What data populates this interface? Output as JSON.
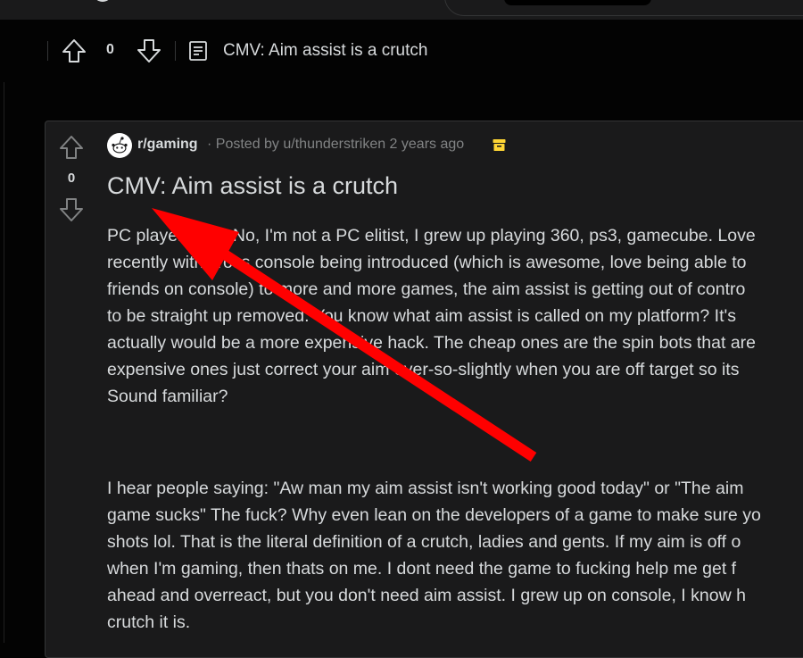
{
  "sticky_header": {
    "vote_count": "0",
    "title": "CMV: Aim assist is a crutch"
  },
  "post": {
    "subreddit": "r/gaming",
    "posted_by": "· Posted by u/thunderstriken 2 years ago",
    "vote_count": "0",
    "title": "CMV: Aim assist is a crutch",
    "paragraphs": [
      [
        "PC player here. No, I'm not a PC elitist, I grew up playing 360, ps3, gamecube. Love",
        "recently with cross console being introduced (which is awesome, love being able to",
        "friends on console) to more and more games, the aim assist is getting out of contro",
        "to be straight up removed. You know what aim assist is called on my platform? It's",
        "actually would be a more expensive hack. The cheap ones are the spin bots that are",
        "expensive ones just correct your aim ever-so-slightly when you are off target so its",
        "Sound familiar?"
      ],
      [
        "I hear people saying: \"Aw man my aim assist isn't working good today\" or \"The aim",
        "game sucks\" The fuck? Why even lean on the developers of a game to make sure yo",
        "shots lol. That is the literal definition of a crutch, ladies and gents. If my aim is off o",
        "when I'm gaming, then thats on me. I dont need the game to fucking help me get f",
        "ahead and overreact, but you don't need aim assist. I grew up on console, I know h",
        "crutch it is."
      ]
    ]
  },
  "icons": {
    "upvote": "upvote-arrow-icon",
    "downvote": "downvote-arrow-icon",
    "post_type": "text-post-icon",
    "archived": "archive-box-icon",
    "avatar": "snoo-avatar-icon",
    "annotation": "red-annotation-arrow"
  },
  "colors": {
    "background": "#030303",
    "card": "#1a1a1b",
    "text": "#d7dadc",
    "muted": "#818384",
    "archive": "#ffd635",
    "annotation": "#ff0000"
  }
}
